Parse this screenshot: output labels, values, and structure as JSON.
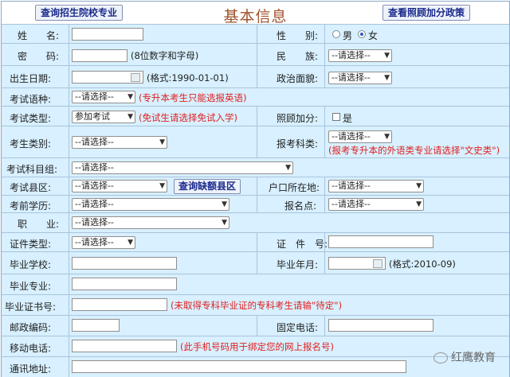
{
  "header": {
    "title": "基本信息",
    "btn_left": "查询招生院校专业",
    "btn_right": "查看照顾加分政策"
  },
  "form": {
    "name_label": "姓　　名:",
    "gender_label": "性　　别:",
    "gender_male": "男",
    "gender_female": "女",
    "gender_selected": "女",
    "password_label": "密　　码:",
    "password_hint": "(8位数字和字母)",
    "ethnic_label": "民　　族:",
    "select_placeholder": "--请选择--",
    "birth_label": "出生日期:",
    "birth_hint": "(格式:1990-01-01)",
    "political_label": "政治面貌:",
    "lang_label": "考试语种:",
    "lang_hint": "(专升本考生只能选报英语)",
    "exam_type_label": "考试类型:",
    "exam_type_value": "参加考试",
    "exam_type_hint": "(免试生请选择免试入学)",
    "bonus_label": "照顾加分:",
    "bonus_yes": "是",
    "category_label": "考生类别:",
    "subject_label": "报考科类:",
    "subject_hint": "(报考专升本的外语类专业请选择\"文史类\")",
    "group_label": "考试科目组:",
    "district_label": "考试县区:",
    "district_btn": "查询缺额县区",
    "hukou_label": "户口所在地:",
    "edu_label": "考前学历:",
    "site_label": "报名点:",
    "job_label": "职　　业:",
    "idtype_label": "证件类型:",
    "idno_label": "证　件　号:",
    "school_label": "毕业学校:",
    "gradyear_label": "毕业年月:",
    "gradyear_hint": "(格式:2010-09)",
    "major_label": "毕业专业:",
    "cert_label": "毕业证书号:",
    "cert_hint": "(未取得专科毕业证的专科考生请输\"待定\")",
    "postcode_label": "邮政编码:",
    "phone_label": "固定电话:",
    "mobile_label": "移动电话:",
    "mobile_hint": "(此手机号码用于绑定您的网上报名号)",
    "address_label": "通讯地址:"
  },
  "watermark": "红鹰教育",
  "colors": {
    "row_bg": "#d8f0ff",
    "title": "#a0522d",
    "hint_red": "#e02020",
    "button_text": "#1a2a8c"
  }
}
